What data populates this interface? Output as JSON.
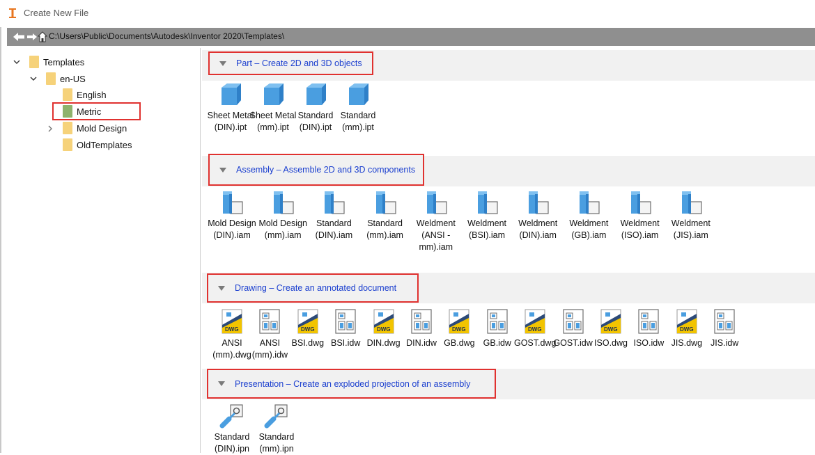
{
  "window": {
    "title": "Create New File",
    "icon": "inventor-app-icon"
  },
  "address_bar": {
    "path": "C:\\Users\\Public\\Documents\\Autodesk\\Inventor 2020\\Templates\\"
  },
  "tree": {
    "items": [
      {
        "label": "Templates",
        "level": 0,
        "expander": "expanded"
      },
      {
        "label": "en-US",
        "level": 1,
        "expander": "expanded"
      },
      {
        "label": "English",
        "level": 2,
        "expander": "none"
      },
      {
        "label": "Metric",
        "level": 2,
        "expander": "none",
        "selected": true
      },
      {
        "label": "Mold Design",
        "level": 2,
        "expander": "collapsed"
      },
      {
        "label": "OldTemplates",
        "level": 2,
        "expander": "none"
      }
    ]
  },
  "sections": [
    {
      "title": "Part – Create 2D and 3D objects",
      "items": [
        "Sheet Metal (DIN).ipt",
        "Sheet Metal (mm).ipt",
        "Standard (DIN).ipt",
        "Standard (mm).ipt"
      ]
    },
    {
      "title": "Assembly – Assemble 2D and 3D components",
      "items": [
        "Mold Design (DIN).iam",
        "Mold Design (mm).iam",
        "Standard (DIN).iam",
        "Standard (mm).iam",
        "Weldment (ANSI - mm).iam",
        "Weldment (BSI).iam",
        "Weldment (DIN).iam",
        "Weldment (GB).iam",
        "Weldment (ISO).iam",
        "Weldment (JIS).iam"
      ]
    },
    {
      "title": "Drawing – Create an annotated document",
      "items": [
        "ANSI (mm).dwg",
        "ANSI (mm).idw",
        "BSI.dwg",
        "BSI.idw",
        "DIN.dwg",
        "DIN.idw",
        "GB.dwg",
        "GB.idw",
        "GOST.dwg",
        "GOST.idw",
        "ISO.dwg",
        "ISO.idw",
        "JIS.dwg",
        "JIS.idw"
      ],
      "dwg_badge": "DWG"
    },
    {
      "title": "Presentation – Create an exploded projection of an assembly",
      "items": [
        "Standard (DIN).ipn",
        "Standard (mm).ipn"
      ]
    }
  ],
  "colors": {
    "accent_link": "#1b3fcf",
    "highlight_red": "#e0312f",
    "folder": "#f6d27a",
    "part_blue": "#4a9ee0"
  }
}
